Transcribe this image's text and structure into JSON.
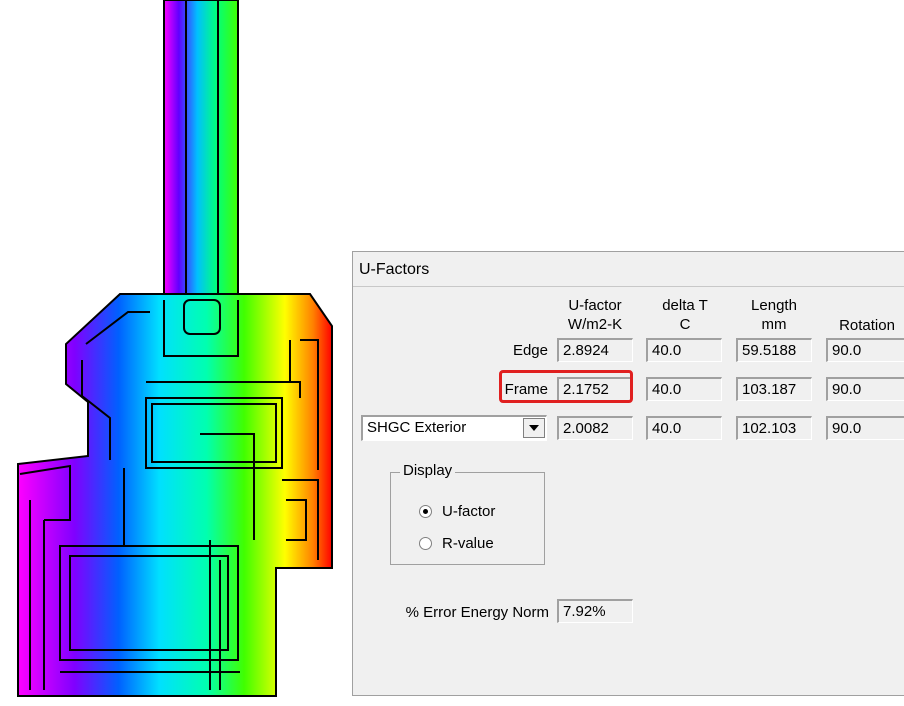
{
  "dialog": {
    "title": "U-Factors",
    "columns": {
      "ufactor": "U-factor\nW/m2-K",
      "deltat": "delta T\nC",
      "length": "Length\nmm",
      "rotation": "Rotation"
    },
    "rows": {
      "edge": {
        "label": "Edge",
        "ufactor": "2.8924",
        "deltat": "40.0",
        "length": "59.5188",
        "rotation": "90.0"
      },
      "frame": {
        "label": "Frame",
        "ufactor": "2.1752",
        "deltat": "40.0",
        "length": "103.187",
        "rotation": "90.0"
      },
      "shgc": {
        "select_value": "SHGC Exterior",
        "ufactor": "2.0082",
        "deltat": "40.0",
        "length": "102.103",
        "rotation": "90.0"
      }
    },
    "display_group": {
      "title": "Display",
      "options": [
        "U-factor",
        "R-value"
      ],
      "selected": "U-factor"
    },
    "error": {
      "label": "% Error Energy Norm",
      "value": "7.92%"
    },
    "highlight_color": "#e02020"
  },
  "thermal_image": {
    "colormap": [
      "#ff00ff",
      "#0000ff",
      "#00ffff",
      "#00ff00",
      "#ffff00",
      "#ff0000"
    ]
  }
}
